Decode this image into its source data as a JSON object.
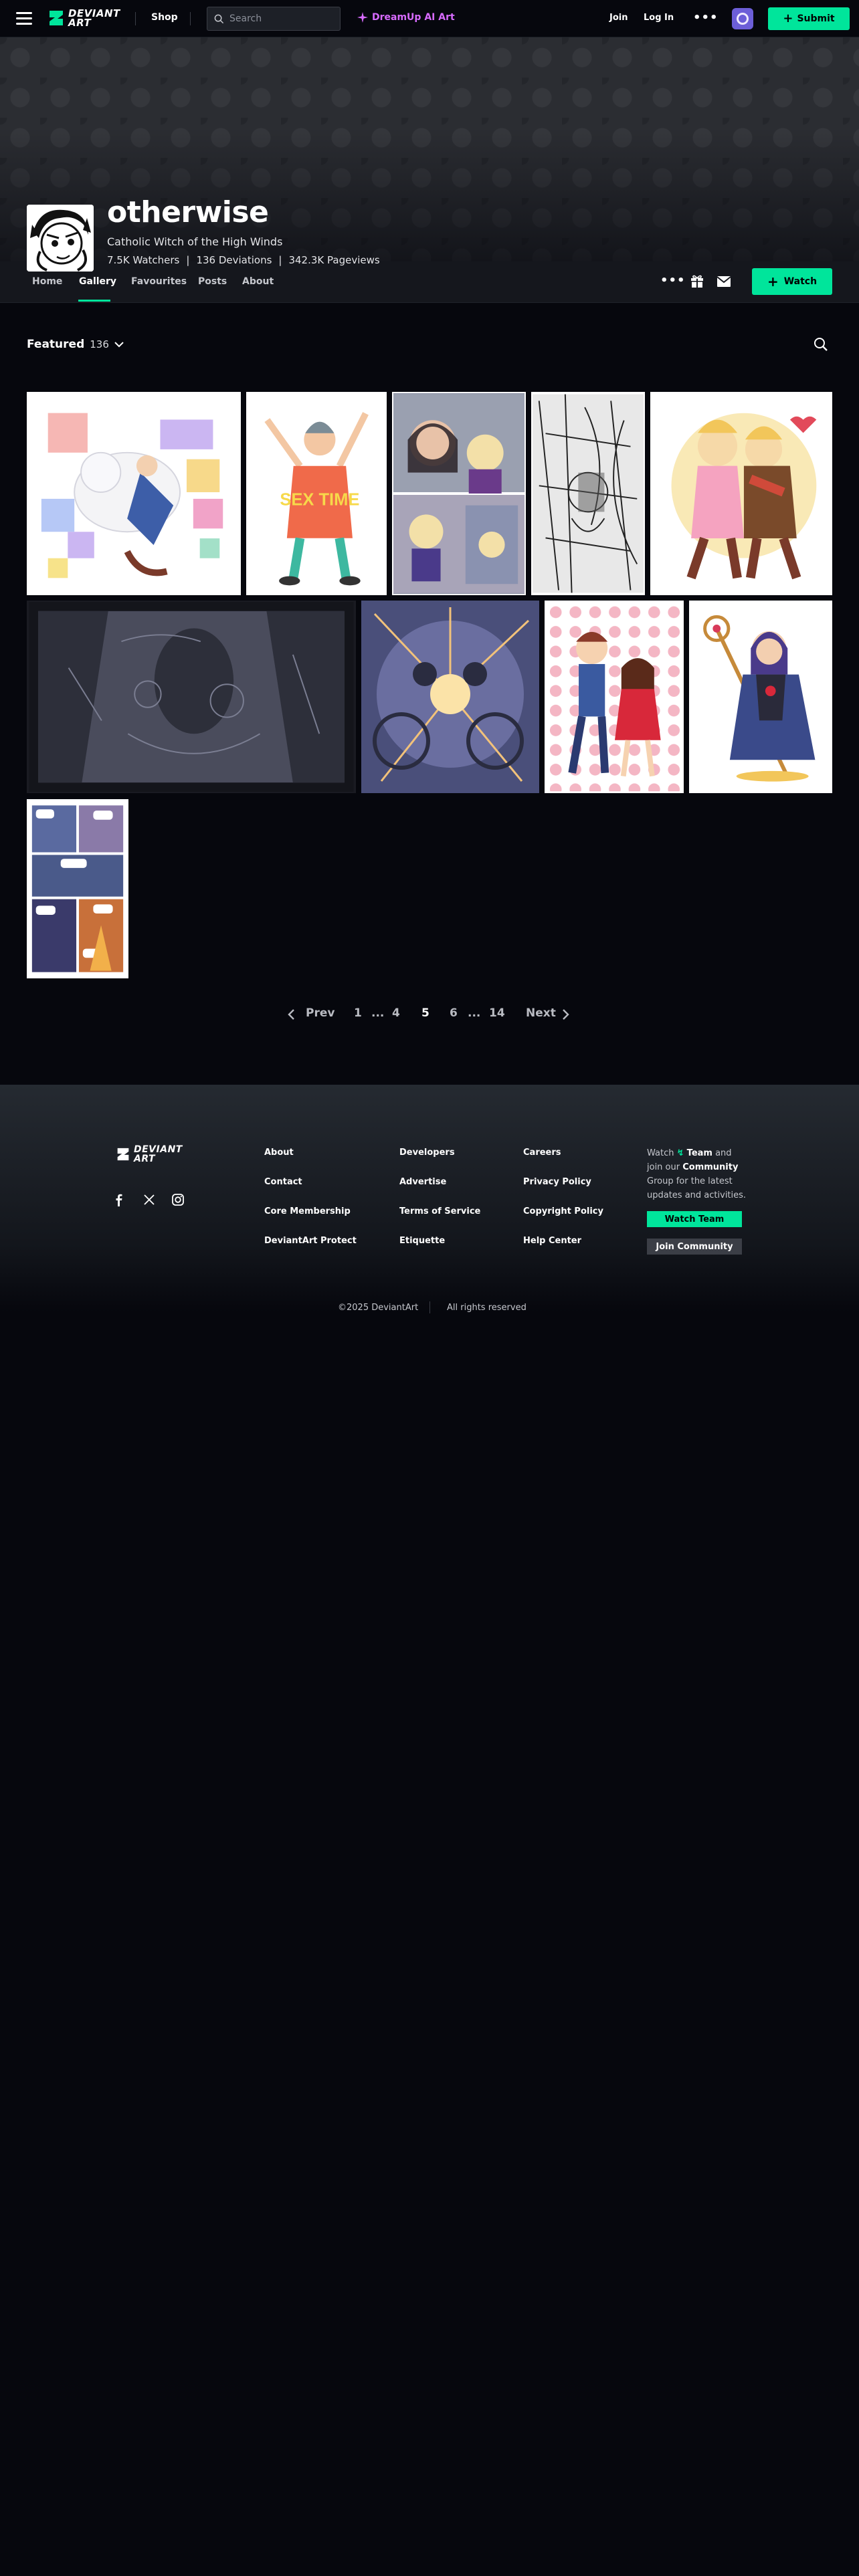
{
  "topnav": {
    "logo_line1": "DEVIANT",
    "logo_line2": "ART",
    "shop": "Shop",
    "search_placeholder": "Search",
    "dreamup": "DreamUp AI Art",
    "join": "Join",
    "login": "Log In",
    "more": "•••",
    "submit": "Submit"
  },
  "profile": {
    "name": "otherwise",
    "tagline": "Catholic Witch of the High Winds",
    "watchers": "7.5K Watchers",
    "deviations": "136 Deviations",
    "pageviews": "342.3K Pageviews",
    "sep": "|"
  },
  "tabs": {
    "home": "Home",
    "gallery": "Gallery",
    "favourites": "Favourites",
    "posts": "Posts",
    "about": "About",
    "more": "•••",
    "watch": "Watch"
  },
  "gallery": {
    "featured_title": "Featured",
    "featured_count": "136",
    "thumb_sex_time_text": "SEX TIME"
  },
  "pagination": {
    "prev": "Prev",
    "pages": [
      "1",
      "...",
      "4",
      "5",
      "6",
      "...",
      "14"
    ],
    "current": "5",
    "next": "Next"
  },
  "footer": {
    "col1": [
      "About",
      "Contact",
      "Core Membership",
      "DeviantArt Protect"
    ],
    "col2": [
      "Developers",
      "Advertise",
      "Terms of Service",
      "Etiquette"
    ],
    "col3": [
      "Careers",
      "Privacy Policy",
      "Copyright Policy",
      "Help Center"
    ],
    "watch_text_1": "Watch",
    "watch_team": "Team",
    "watch_text_2": "and join our",
    "watch_community": "Community",
    "watch_text_3": "Group for the latest updates and activities.",
    "watch_team_btn": "Watch Team",
    "join_community_btn": "Join Community",
    "copyright": "©2025 DeviantArt",
    "rights": "All rights reserved"
  },
  "colors": {
    "accent": "#00e59b",
    "background": "#06070d",
    "dreamup": "#d86bff"
  }
}
